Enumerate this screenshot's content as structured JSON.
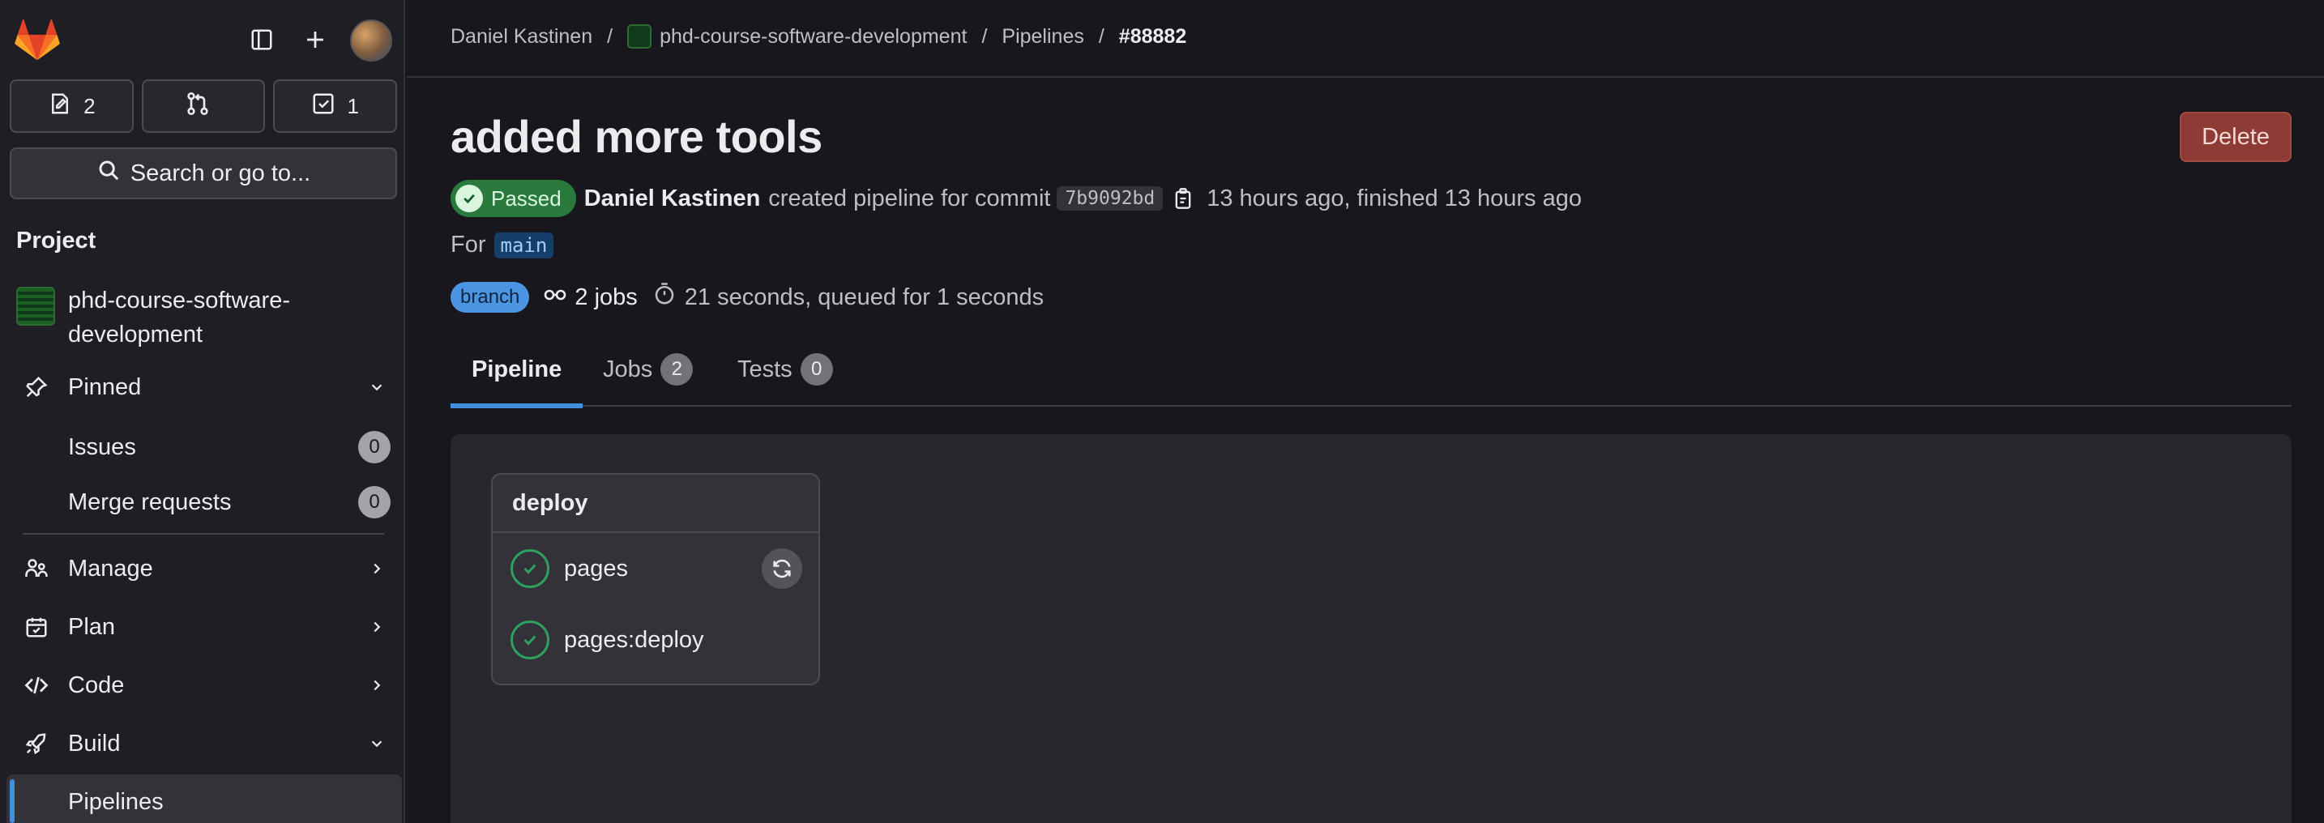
{
  "sidebar": {
    "counters": [
      {
        "icon": "issues-icon",
        "count": "2"
      },
      {
        "icon": "merge-request-icon",
        "count": ""
      },
      {
        "icon": "todo-icon",
        "count": "1"
      }
    ],
    "search_label": "Search or go to...",
    "section_title": "Project",
    "project_name": "phd-course-software-development",
    "pinned_label": "Pinned",
    "pinned_items": [
      {
        "label": "Issues",
        "count": "0"
      },
      {
        "label": "Merge requests",
        "count": "0"
      }
    ],
    "nav": [
      {
        "label": "Manage",
        "icon": "users-icon"
      },
      {
        "label": "Plan",
        "icon": "calendar-icon"
      },
      {
        "label": "Code",
        "icon": "code-icon"
      },
      {
        "label": "Build",
        "icon": "rocket-icon"
      }
    ],
    "active_item": "Pipelines"
  },
  "breadcrumb": [
    "Daniel Kastinen",
    "phd-course-software-development",
    "Pipelines",
    "#88882"
  ],
  "pipeline": {
    "title": "added more tools",
    "delete_label": "Delete",
    "status": "Passed",
    "user": "Daniel Kastinen",
    "action_text": "created pipeline for commit",
    "commit_sha": "7b9092bd",
    "time_text": "13 hours ago, finished 13 hours ago",
    "for_label": "For",
    "ref": "main",
    "branch_badge": "branch",
    "jobs_text": "2 jobs",
    "duration_text": "21 seconds, queued for 1 seconds"
  },
  "tabs": [
    {
      "label": "Pipeline",
      "count": null
    },
    {
      "label": "Jobs",
      "count": "2"
    },
    {
      "label": "Tests",
      "count": "0"
    }
  ],
  "graph": {
    "stage": "deploy",
    "jobs": [
      "pages",
      "pages:deploy"
    ]
  },
  "colors": {
    "accent": "#428fdc",
    "success": "#2da160",
    "danger": "#8d3b34",
    "background": "#18171d"
  }
}
